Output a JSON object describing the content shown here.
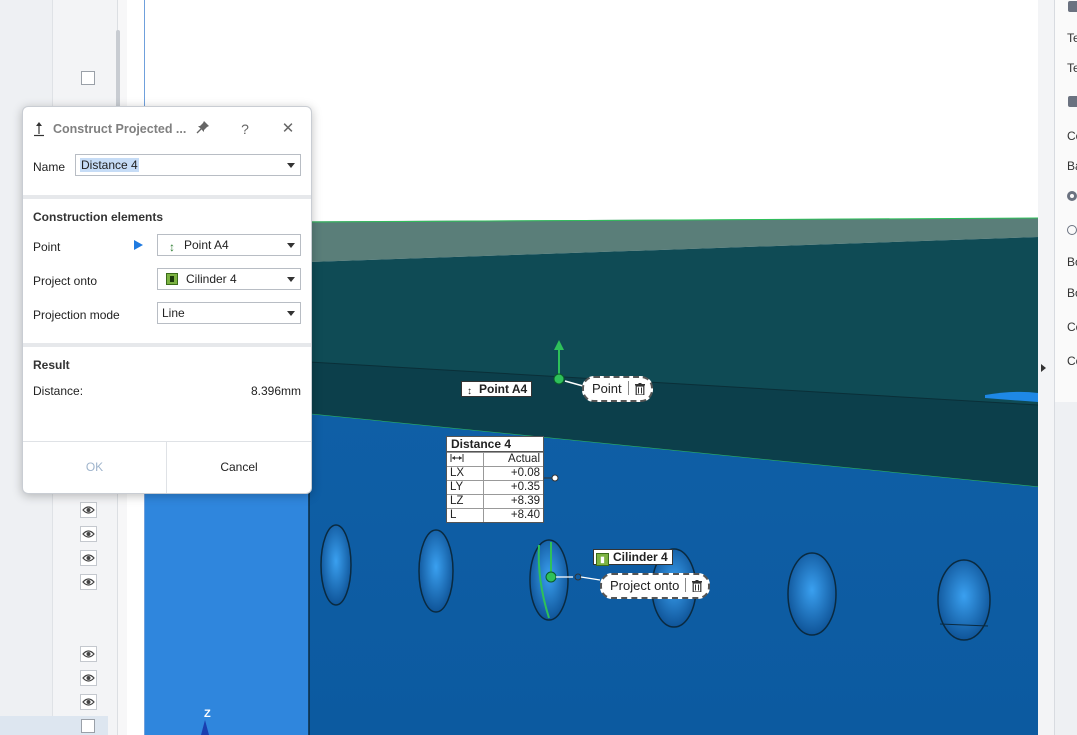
{
  "dialog": {
    "title": "Construct Projected ...",
    "help": "?",
    "close": "✕",
    "name_label": "Name",
    "name_value": "Distance 4",
    "section_construction": "Construction elements",
    "point_label": "Point",
    "point_value": "Point A4",
    "project_onto_label": "Project onto",
    "project_onto_value": "Cilinder 4",
    "projection_mode_label": "Projection mode",
    "projection_mode_value": "Line",
    "section_result": "Result",
    "distance_label": "Distance:",
    "distance_value": "8.396mm",
    "ok_label": "OK",
    "cancel_label": "Cancel"
  },
  "scene": {
    "point_tag": "Point A4",
    "point_bubble": "Point",
    "cylinder_tag": "Cilinder 4",
    "cylinder_bubble": "Project onto",
    "axis_z": "Z",
    "distance_table": {
      "title": "Distance 4",
      "header": "Actual",
      "rows": [
        {
          "key": "LX",
          "value": "+0.08"
        },
        {
          "key": "LY",
          "value": "+0.35"
        },
        {
          "key": "LZ",
          "value": "+8.39"
        },
        {
          "key": "L",
          "value": "+8.40"
        }
      ]
    }
  },
  "right_panel": {
    "items": [
      "Te",
      "Te",
      "Co",
      "Ba",
      "Bo",
      "Bo",
      "Co",
      "Co"
    ]
  },
  "colors": {
    "accent": "#1f7ae0",
    "top_face": "#5b7f78",
    "dark_face": "#0f4a54",
    "front_face": "#0d5ea8",
    "highlight_green": "#2ec05a"
  }
}
